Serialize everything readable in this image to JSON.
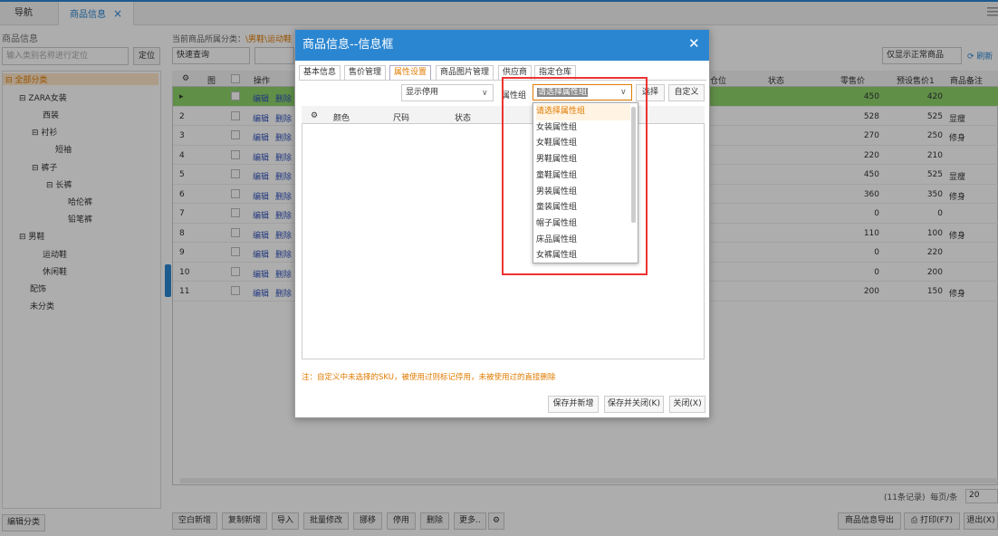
{
  "tabs": {
    "nav": "导航",
    "goods": "商品信息",
    "close": "×"
  },
  "left": {
    "title": "商品信息",
    "search_placeholder": "输入类别名称进行定位",
    "locate": "定位",
    "tree": [
      "⊟ 全部分类",
      "⊟ ZARA女装",
      "西装",
      "⊟ 衬衫",
      "短袖",
      "⊟ 裤子",
      "⊟ 长裤",
      "哈伦裤",
      "铅笔裤",
      "⊟ 男鞋",
      "运动鞋",
      "休闲鞋",
      "配饰",
      "未分类"
    ],
    "edit_category": "编辑分类"
  },
  "main": {
    "current_category_label": "当前商品所属分类：",
    "current_category_value": "\\男鞋\\运动鞋",
    "quick_query": "快速查询",
    "filter": "仅显示正常商品",
    "refresh": "刷新",
    "grid_headers": {
      "img": "图",
      "op": "操作",
      "loc": "仓位",
      "status": "状态",
      "retail": "零售价",
      "preset": "预设售价1",
      "remark": "商品备注"
    },
    "rows": [
      {
        "n": "▸",
        "edit": "编辑",
        "del": "删除",
        "retail": "450",
        "preset": "420",
        "remark": ""
      },
      {
        "n": "2",
        "edit": "编辑",
        "del": "删除",
        "retail": "528",
        "preset": "525",
        "remark": "显瘦"
      },
      {
        "n": "3",
        "edit": "编辑",
        "del": "删除",
        "retail": "270",
        "preset": "250",
        "remark": "修身"
      },
      {
        "n": "4",
        "edit": "编辑",
        "del": "删除",
        "retail": "220",
        "preset": "210",
        "remark": ""
      },
      {
        "n": "5",
        "edit": "编辑",
        "del": "删除",
        "retail": "450",
        "preset": "525",
        "remark": "显瘦"
      },
      {
        "n": "6",
        "edit": "编辑",
        "del": "删除",
        "retail": "360",
        "preset": "350",
        "remark": "修身"
      },
      {
        "n": "7",
        "edit": "编辑",
        "del": "删除",
        "retail": "0",
        "preset": "0",
        "remark": ""
      },
      {
        "n": "8",
        "edit": "编辑",
        "del": "删除",
        "retail": "110",
        "preset": "100",
        "remark": "修身"
      },
      {
        "n": "9",
        "edit": "编辑",
        "del": "删除",
        "retail": "0",
        "preset": "220",
        "remark": ""
      },
      {
        "n": "10",
        "edit": "编辑",
        "del": "删除",
        "retail": "0",
        "preset": "200",
        "remark": ""
      },
      {
        "n": "11",
        "edit": "编辑",
        "del": "删除",
        "retail": "200",
        "preset": "150",
        "remark": "修身"
      }
    ],
    "pager_count": "(11条记录)",
    "per_page_label": "每页/条",
    "per_page": "20",
    "bottom_buttons": [
      "空白新增",
      "复制新增",
      "导入",
      "批量修改",
      "挪移",
      "停用",
      "删除",
      "更多.."
    ],
    "export": "商品信息导出",
    "print": "打印(F7)",
    "exit": "退出(X)"
  },
  "dialog": {
    "title": "商品信息--信息框",
    "close": "✕",
    "tabs": [
      "基本信息",
      "售价管理",
      "属性设置",
      "商品图片管理",
      "供应商",
      "指定仓库"
    ],
    "show_select": "显示停用",
    "attr_label": "属性组",
    "attr_select": "请选择属性组",
    "pick": "选择",
    "custom": "自定义",
    "inner_headers": {
      "color": "颜色",
      "size": "尺码",
      "status": "状态"
    },
    "note": "注：自定义中未选择的SKU，被使用过则标记停用，未被使用过的直接删除",
    "save_new": "保存并新增",
    "save_close": "保存并关闭(K)",
    "close_btn": "关闭(X)",
    "dropdown": [
      "请选择属性组",
      "女装属性组",
      "女鞋属性组",
      "男鞋属性组",
      "童鞋属性组",
      "男装属性组",
      "童装属性组",
      "帽子属性组",
      "床品属性组",
      "女裤属性组"
    ]
  },
  "colors": {
    "accent": "#2b86d1",
    "highlight_row": "#8ed36b",
    "orange": "#e07b00",
    "red_box": "#e33333"
  }
}
